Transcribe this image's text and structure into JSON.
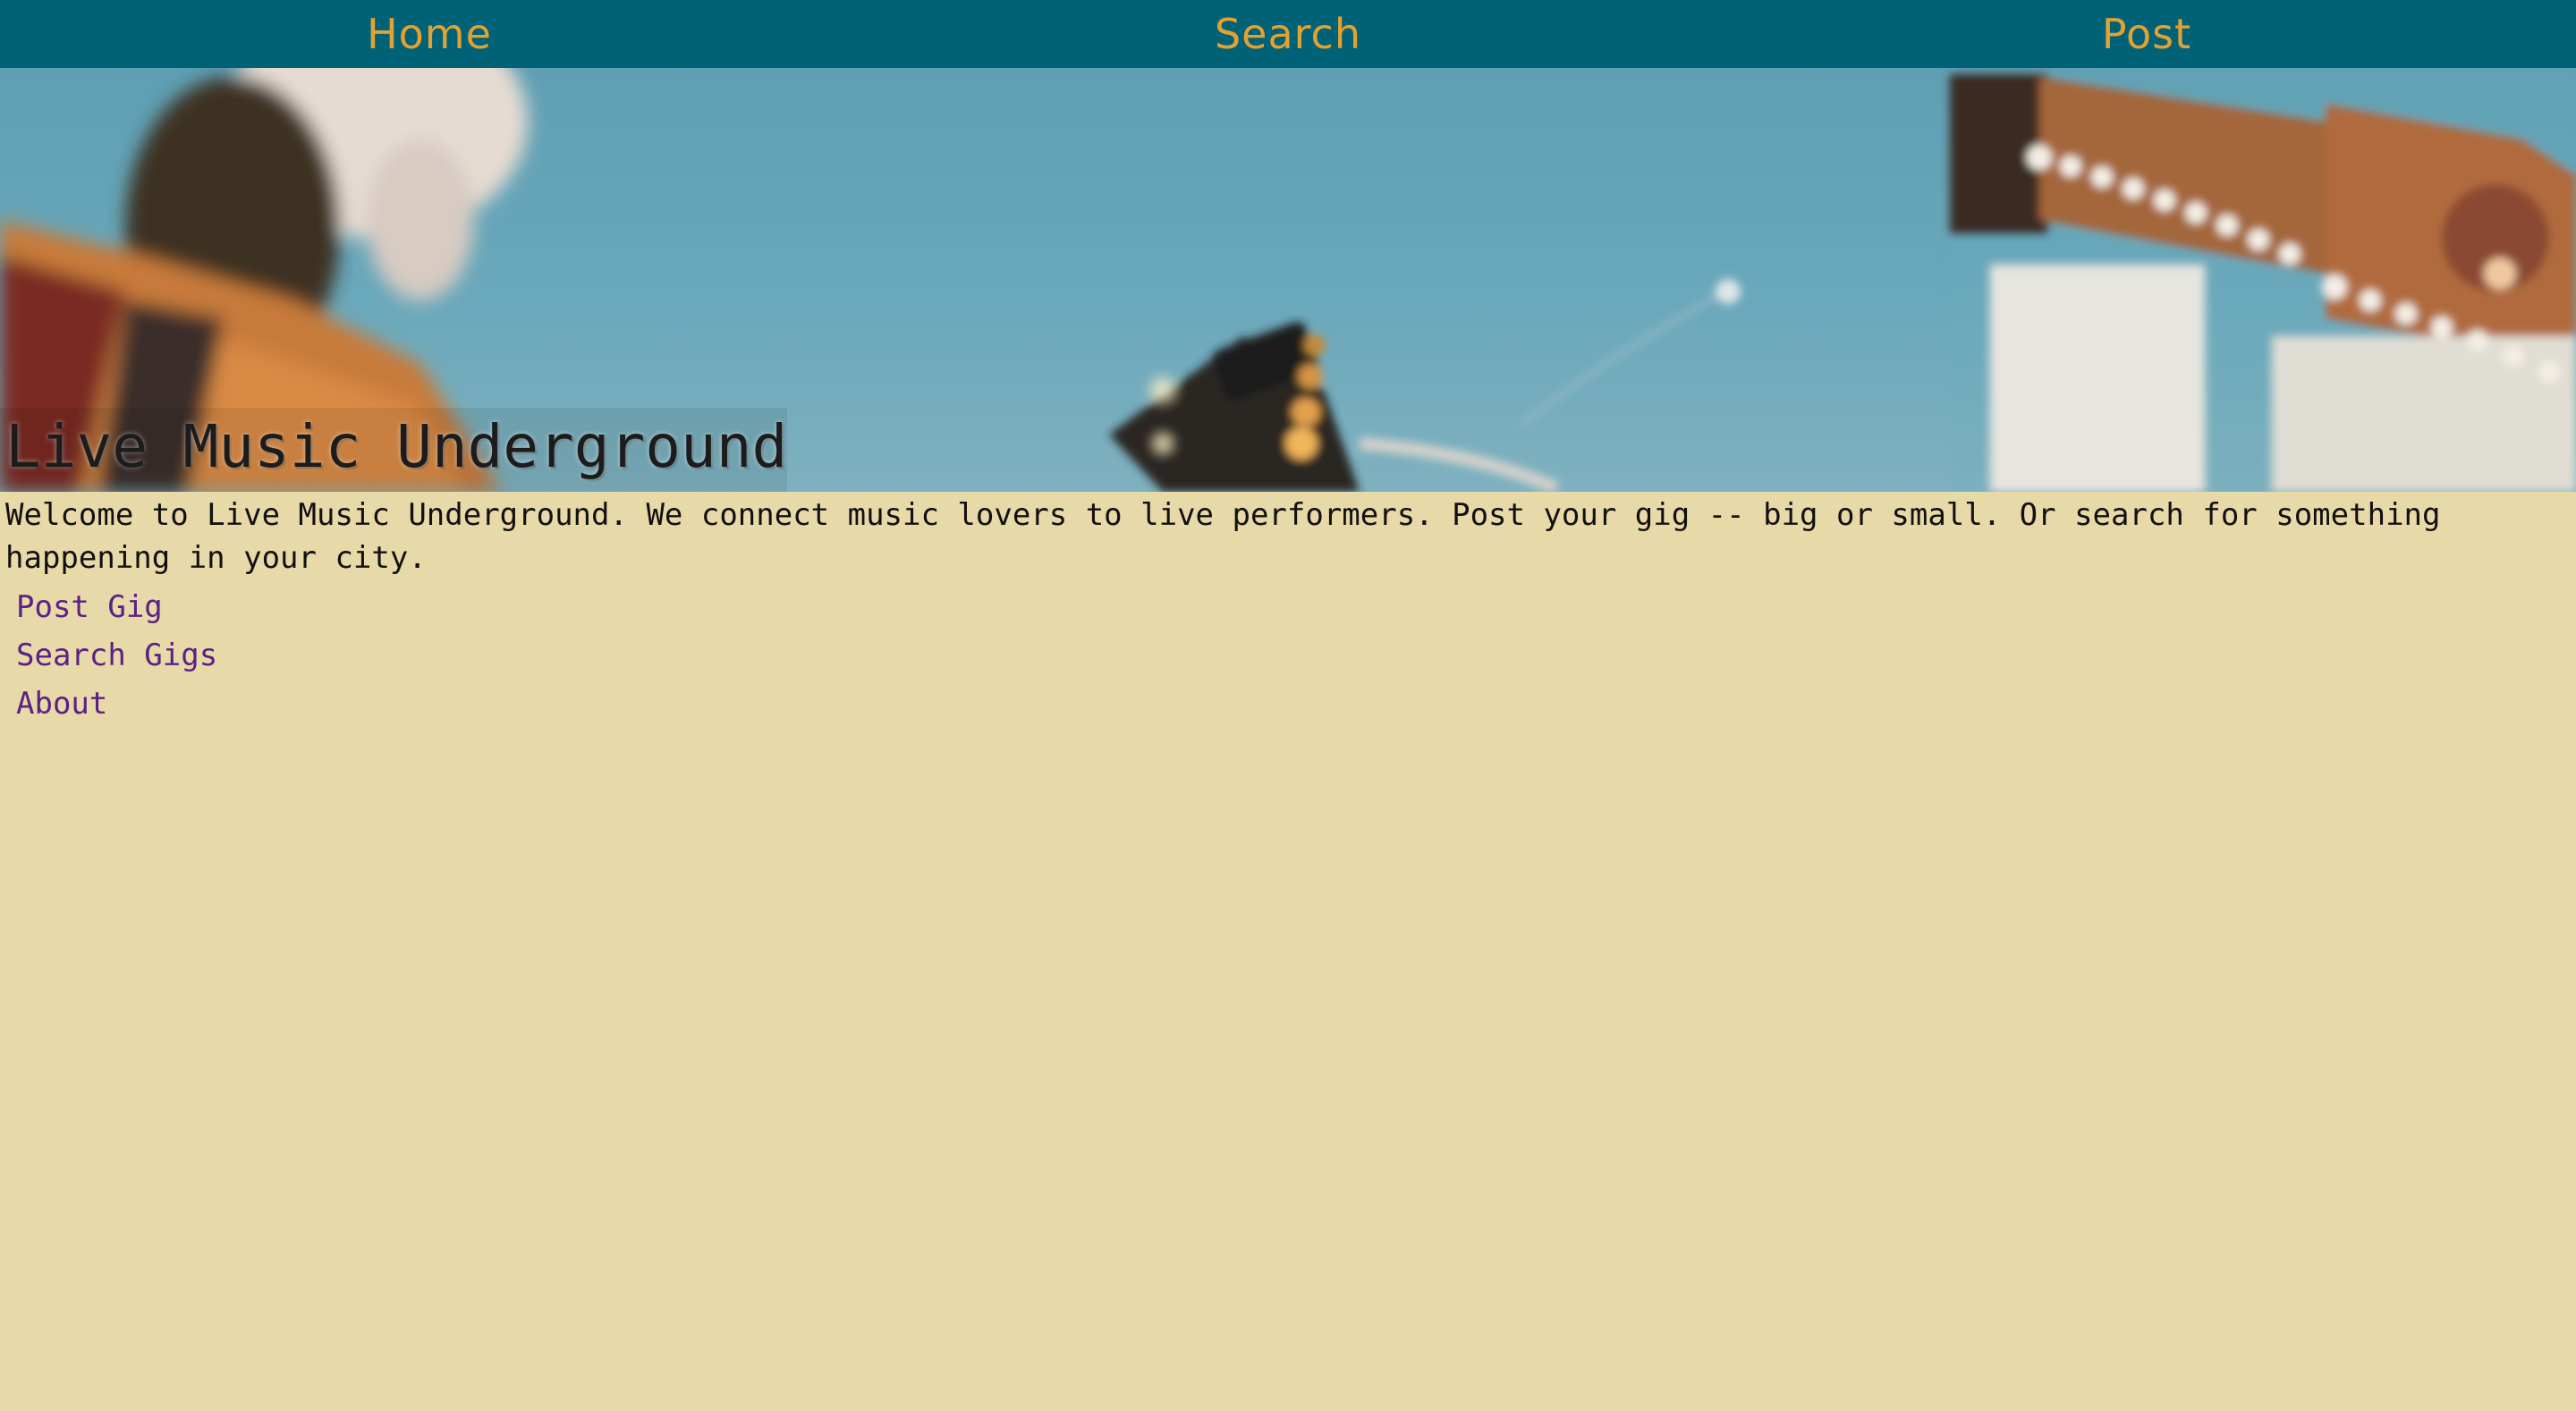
{
  "nav": {
    "home_label": "Home",
    "search_label": "Search",
    "post_label": "Post"
  },
  "hero": {
    "title": "Live Music Underground",
    "image_icon": "concert-photo"
  },
  "welcome": {
    "text": "Welcome to Live Music Underground. We connect music lovers to live performers. Post your gig -- big or small. Or search for something happening in your city."
  },
  "links": {
    "post_gig": "Post Gig",
    "search_gigs": "Search Gigs",
    "about": "About"
  },
  "colors": {
    "nav_bg": "#006277",
    "nav_text": "#e3a131",
    "page_bg": "#e8d9a8",
    "link": "#5b2183"
  }
}
